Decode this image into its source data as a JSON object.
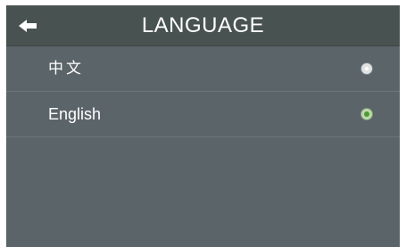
{
  "header": {
    "title": "LANGUAGE",
    "back_icon": "arrow-left-icon"
  },
  "languages": [
    {
      "label": "中文",
      "selected": false
    },
    {
      "label": "English",
      "selected": true
    }
  ],
  "colors": {
    "header_bg": "#485250",
    "content_bg": "#5b6469",
    "text": "#ffffff",
    "selected_radio": "#4f9a35"
  }
}
